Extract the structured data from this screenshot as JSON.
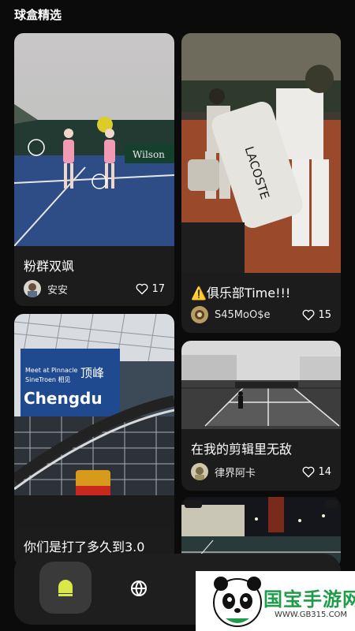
{
  "header": {
    "section_title": "球盒精选"
  },
  "cards": [
    {
      "title": "粉群双飒",
      "author": "安安",
      "likes": "17",
      "photo_text": "Wilson"
    },
    {
      "title": "⚠️俱乐部Time!!!",
      "author": "S45MoO$e",
      "likes": "15",
      "photo_text": "LACOSTE"
    },
    {
      "title": "你们是打了多久到3.0",
      "author": "",
      "likes": "",
      "photo_text": [
        "Meet at Pinnacle",
        "SineTroen 相见",
        "Chengdu",
        "顶峰"
      ]
    },
    {
      "title": "在我的剪辑里无敌",
      "author": "律界阿卡",
      "likes": "14",
      "photo_text": ""
    },
    {
      "title": "",
      "author": "",
      "likes": "",
      "photo_text": ""
    }
  ],
  "bottom_nav": {
    "items": [
      {
        "icon": "home-ball-icon",
        "active": true
      },
      {
        "icon": "globe-icon",
        "active": false
      }
    ]
  },
  "watermark": {
    "name": "国宝手游网",
    "url": "WWW.GB315.COM"
  },
  "colors": {
    "background": "#0b0b0b",
    "card": "#1c1c1c",
    "accent": "#d8e84a"
  }
}
